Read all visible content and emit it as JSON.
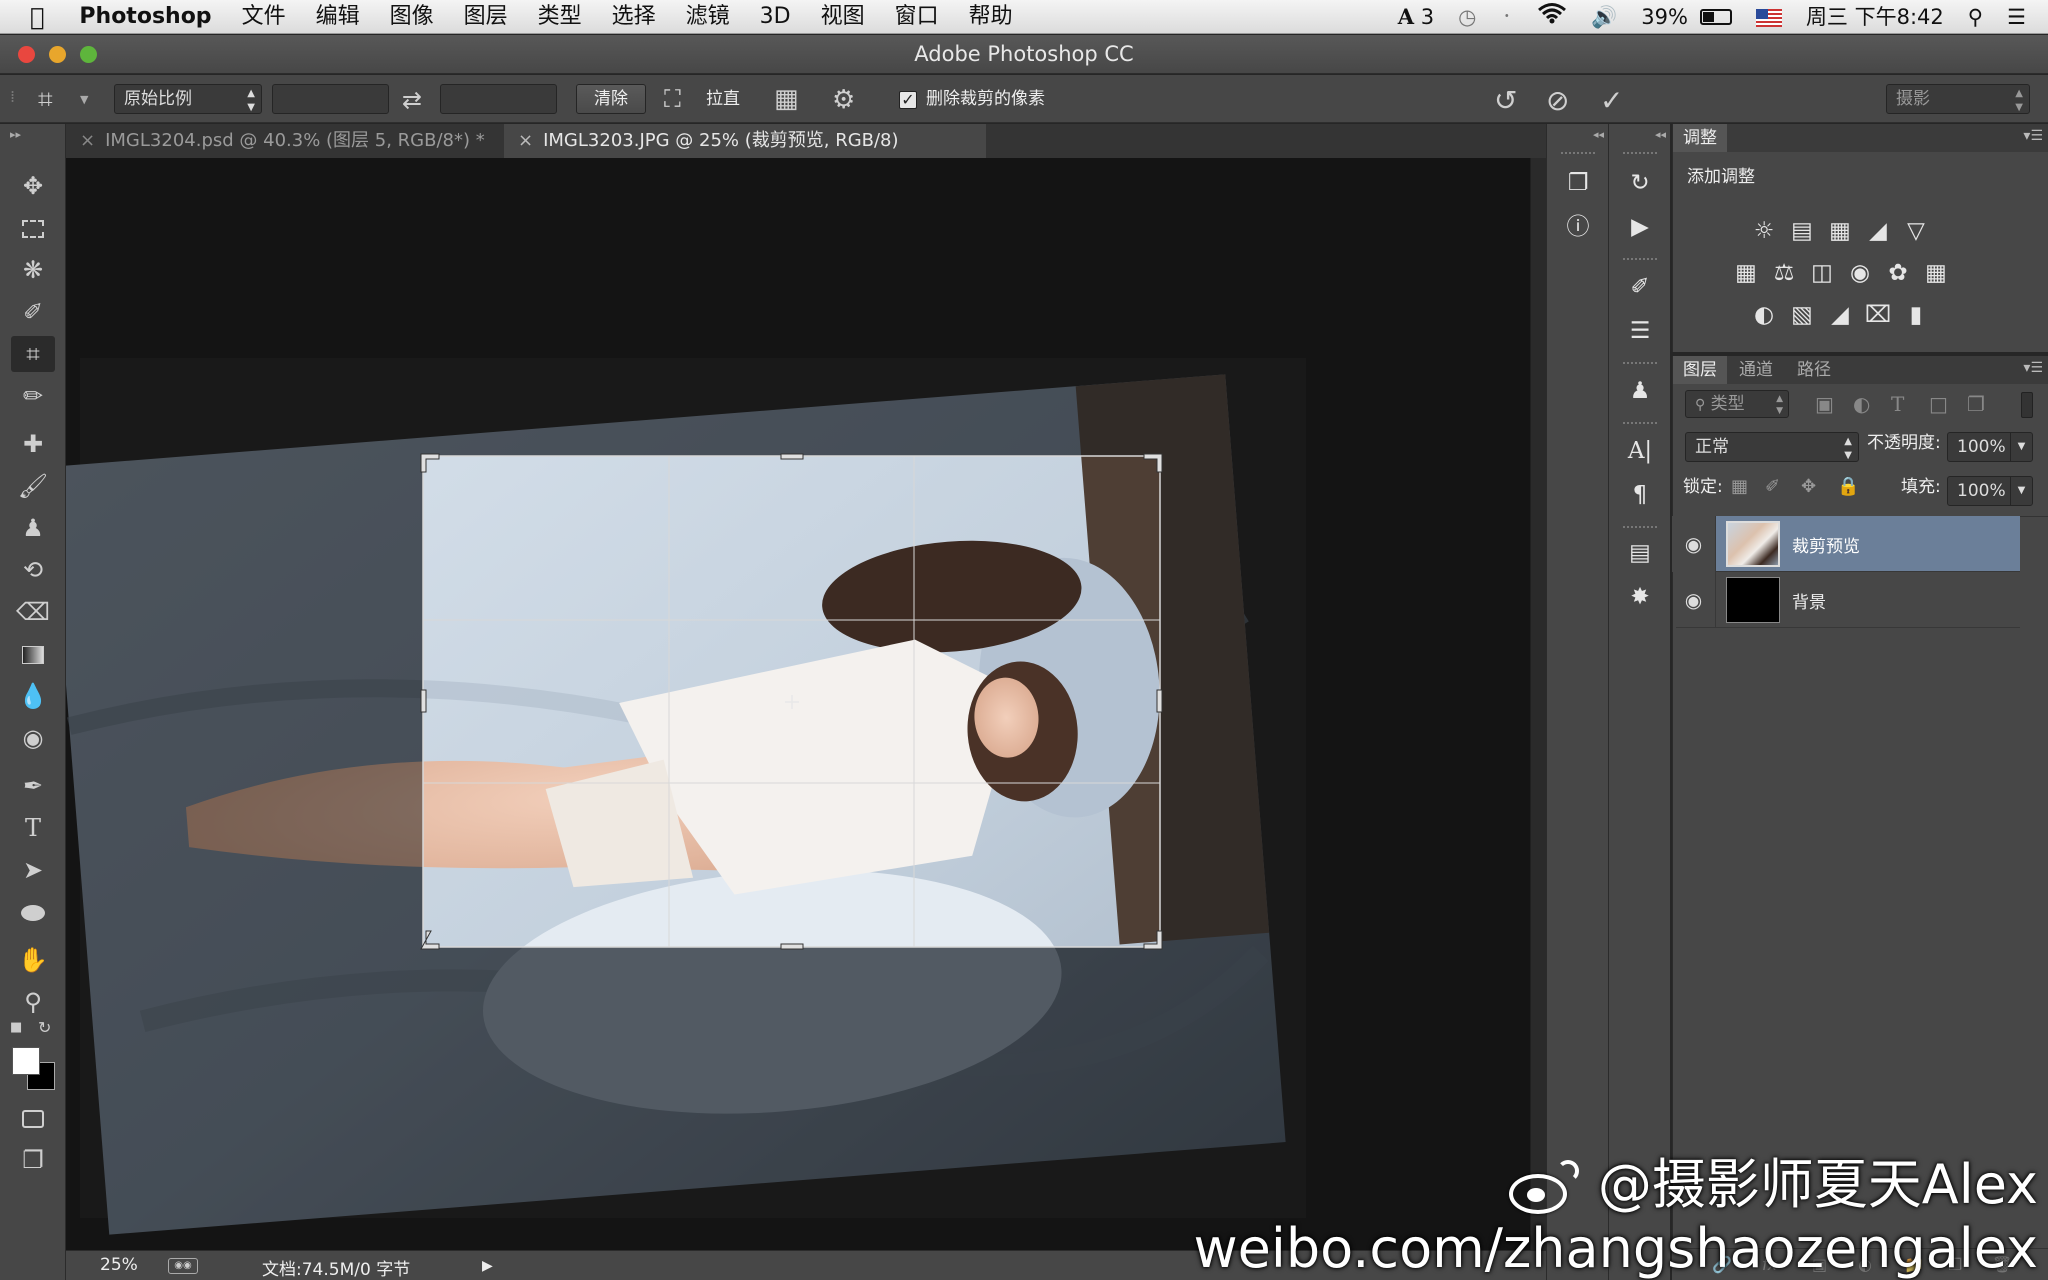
{
  "menubar": {
    "apple_icon": "apple-icon",
    "app_name": "Photoshop",
    "items": [
      "文件",
      "编辑",
      "图像",
      "图层",
      "类型",
      "选择",
      "滤镜",
      "3D",
      "视图",
      "窗口",
      "帮助"
    ],
    "status": {
      "adobe_badge": "3",
      "battery": "39%",
      "clock": "周三 下午8:42"
    }
  },
  "window": {
    "title": "Adobe Photoshop CC"
  },
  "options": {
    "ratio_select": "原始比例",
    "clear_button": "清除",
    "straighten_label": "拉直",
    "delete_cropped_label": "删除裁剪的像素",
    "delete_cropped_checked": true,
    "workspace_select": "摄影"
  },
  "tabs": [
    {
      "label": "IMGL3204.psd @ 40.3% (图层 5, RGB/8*) *",
      "active": false
    },
    {
      "label": "IMGL3203.JPG @ 25% (裁剪预览, RGB/8)",
      "active": true
    }
  ],
  "adjustments": {
    "tab": "调整",
    "subtitle": "添加调整",
    "row1": [
      "brightness-icon",
      "levels-icon",
      "curves-icon",
      "exposure-icon",
      "vibrance-icon"
    ],
    "row2": [
      "hue-saturation-icon",
      "color-balance-icon",
      "black-white-icon",
      "photo-filter-icon",
      "channel-mixer-icon",
      "color-lookup-icon"
    ],
    "row3": [
      "invert-icon",
      "posterize-icon",
      "threshold-icon",
      "selective-color-icon",
      "gradient-map-icon"
    ]
  },
  "layers_panel": {
    "tabs": [
      "图层",
      "通道",
      "路径"
    ],
    "filter_select": "类型",
    "blend_mode": "正常",
    "opacity_label": "不透明度:",
    "opacity_value": "100%",
    "lock_label": "锁定:",
    "fill_label": "填充:",
    "fill_value": "100%",
    "layers": [
      {
        "name": "裁剪预览",
        "selected": true
      },
      {
        "name": "背景",
        "selected": false
      }
    ]
  },
  "status": {
    "zoom": "25%",
    "doc_info": "文档:74.5M/0 字节"
  },
  "watermark": {
    "line1": "@摄影师夏天Alex",
    "line2": "weibo.com/zhangshaozengalex"
  },
  "colors": {
    "accent_selected_layer": "#6b7f99",
    "panel_bg": "#474747",
    "canvas_bg": "#262626"
  }
}
